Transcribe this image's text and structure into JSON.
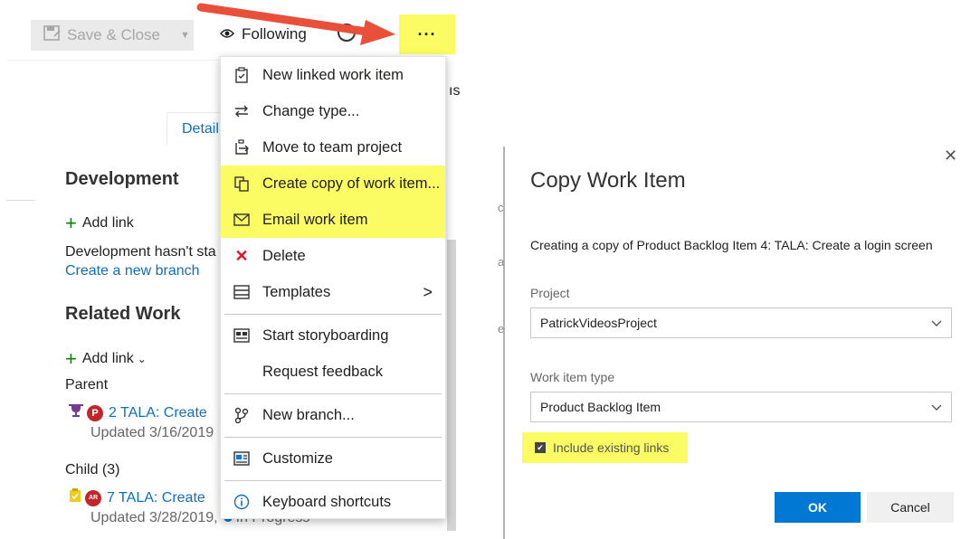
{
  "toolbar": {
    "save_close": "Save & Close",
    "following": "Following",
    "more": "···"
  },
  "workitem": {
    "details_tab": "Detail",
    "peek_text": "ıs",
    "development": {
      "title": "Development",
      "add_link": "Add link",
      "empty_text": "Development hasn't sta",
      "create_branch": "Create a new branch"
    },
    "related": {
      "title": "Related Work",
      "add_link": "Add link",
      "parent_label": "Parent",
      "parent_item": {
        "avatar": "P",
        "text": "2 TALA: Create",
        "updated": "Updated 3/16/2019"
      },
      "child_label": "Child (3)",
      "child_item": {
        "avatar": "AR",
        "text": "7 TALA: Create",
        "updated": "Updated 3/28/2019,",
        "state": "In Progress"
      }
    }
  },
  "menu": {
    "items": [
      {
        "label": "New linked work item",
        "icon": "clipboard-link-icon"
      },
      {
        "label": "Change type...",
        "icon": "swap-arrows-icon"
      },
      {
        "label": "Move to team project",
        "icon": "move-export-icon"
      },
      {
        "label": "Create copy of work item...",
        "icon": "copy-icon",
        "highlighted": true
      },
      {
        "label": "Email work item",
        "icon": "mail-icon",
        "highlighted": true
      },
      {
        "label": "Delete",
        "icon": "delete-x-icon"
      },
      {
        "label": "Templates",
        "icon": "templates-icon",
        "submenu": true
      },
      {
        "label": "Start storyboarding",
        "icon": "storyboard-icon"
      },
      {
        "label": "Request feedback",
        "icon": ""
      },
      {
        "label": "New branch...",
        "icon": "branch-icon"
      },
      {
        "label": "Customize",
        "icon": "customize-icon"
      },
      {
        "label": "Keyboard shortcuts",
        "icon": "info-icon"
      }
    ]
  },
  "dialog": {
    "title": "Copy Work Item",
    "description": "Creating a copy of Product Backlog Item 4: TALA: Create a login screen",
    "project_label": "Project",
    "project_value": "PatrickVideosProject",
    "type_label": "Work item type",
    "type_value": "Product Backlog Item",
    "include_links": "Include existing links",
    "ok": "OK",
    "cancel": "Cancel"
  },
  "colors": {
    "highlight": "#fbfb63",
    "accent": "#0078d4",
    "link": "#106ebe",
    "annotation_arrow": "#e8503a"
  }
}
